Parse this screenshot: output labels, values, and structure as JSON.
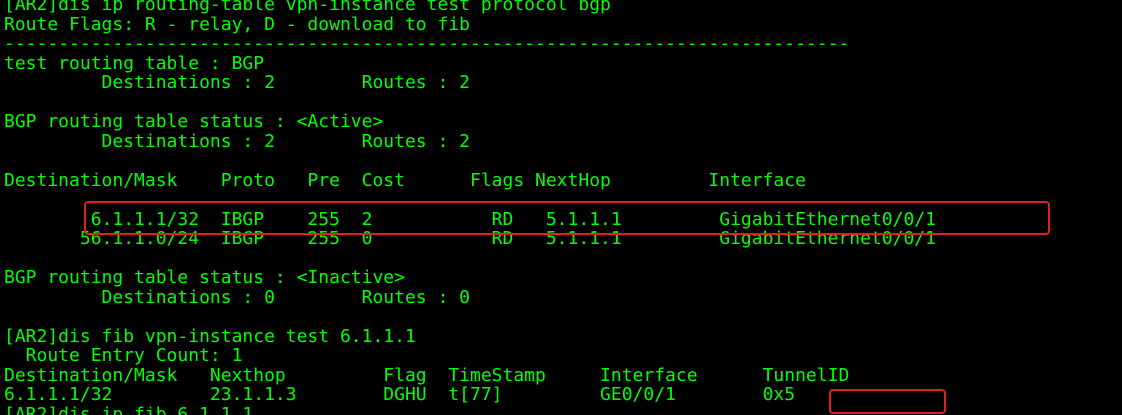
{
  "terminal": {
    "text_color": "#00ff00",
    "background_color": "#000000",
    "highlight_color": "#e0201e",
    "lines": [
      "[AR2]dis ip routing-table vpn-instance test protocol bgp",
      "Route Flags: R - relay, D - download to fib",
      "------------------------------------------------------------------------------",
      "test routing table : BGP",
      "         Destinations : 2        Routes : 2",
      "",
      "BGP routing table status : <Active>",
      "         Destinations : 2        Routes : 2",
      "",
      "Destination/Mask    Proto   Pre  Cost      Flags NextHop         Interface",
      "",
      "        6.1.1.1/32  IBGP    255  2           RD   5.1.1.1         GigabitEthernet0/0/1",
      "       56.1.1.0/24  IBGP    255  0           RD   5.1.1.1         GigabitEthernet0/0/1",
      "",
      "BGP routing table status : <Inactive>",
      "         Destinations : 0        Routes : 0",
      "",
      "[AR2]dis fib vpn-instance test 6.1.1.1",
      "  Route Entry Count: 1",
      "Destination/Mask   Nexthop         Flag  TimeStamp     Interface      TunnelID",
      "6.1.1.1/32         23.1.1.3        DGHU  t[77]         GE0/0/1        0x5",
      "[AR2]dis ip fib 6.1.1.1"
    ]
  }
}
